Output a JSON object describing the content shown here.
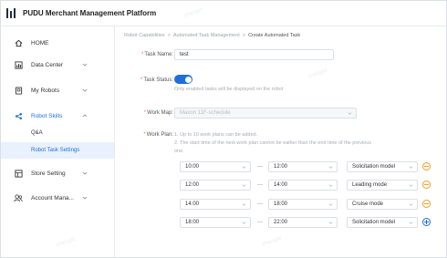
{
  "app": {
    "title": "PUDU Merchant Management Platform"
  },
  "sidebar": {
    "items": [
      {
        "label": "HOME",
        "icon": "home-icon"
      },
      {
        "label": "Data Center",
        "icon": "chart-icon"
      },
      {
        "label": "My Robots",
        "icon": "robot-icon"
      },
      {
        "label": "Robot Skills",
        "icon": "share-icon"
      },
      {
        "label": "Store Setting",
        "icon": "store-icon"
      },
      {
        "label": "Account Mana...",
        "icon": "account-icon"
      }
    ],
    "sub_items": [
      {
        "label": "Q&A"
      },
      {
        "label": "Robot Task Settings"
      }
    ]
  },
  "breadcrumb": {
    "items": [
      "Robot Capabilities",
      "Automated Task Management",
      "Create Automated Task"
    ],
    "separator": ">"
  },
  "form": {
    "task_name": {
      "label": "Task Name:",
      "required": "*",
      "value": "test"
    },
    "task_status": {
      "label": "Task Status:",
      "required": "*",
      "enabled": true,
      "hint": "Only enabled tasks will be displayed on the robot"
    },
    "work_map": {
      "label": "Work Map:",
      "required": "*",
      "value": "Maxon 11F-schedule"
    },
    "work_plan": {
      "label": "Work Plan:",
      "required": "*",
      "hint_line1": "1. Up to 10 work plans can be added.",
      "hint_line2": "2. The start time of the next work plan cannot be earlier than the end time of the previous",
      "hint_line3": "one.",
      "dash": "—",
      "rows": [
        {
          "start": "10:00",
          "end": "12:00",
          "mode": "Solicitation model",
          "action": "remove"
        },
        {
          "start": "12:00",
          "end": "14:00",
          "mode": "Leading mode",
          "action": "remove"
        },
        {
          "start": "14:00",
          "end": "18:00",
          "mode": "Cruise mode",
          "action": "remove"
        },
        {
          "start": "18:00",
          "end": "22:00",
          "mode": "Solicitation model",
          "action": "add"
        }
      ]
    }
  },
  "watermark": {
    "text": "shangjie"
  },
  "colors": {
    "accent": "#1e6fd9",
    "required": "#f56c6c",
    "remove": "#f0a020"
  }
}
